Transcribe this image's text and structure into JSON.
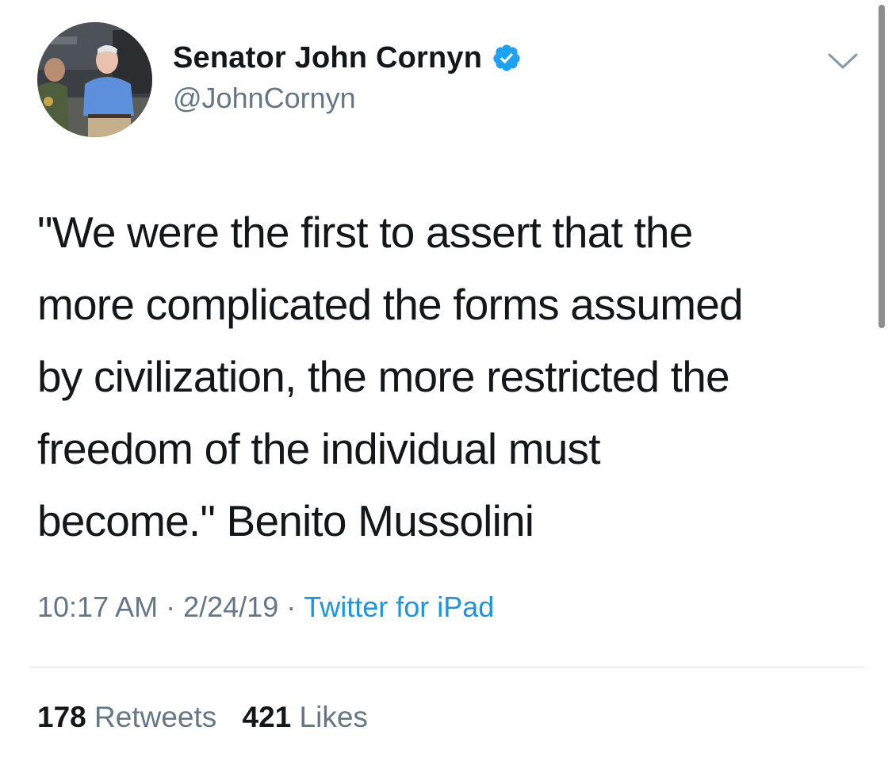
{
  "tweet": {
    "display_name": "Senator John Cornyn",
    "handle": "@JohnCornyn",
    "text": "\"We were the first to assert that the\nmore complicated the forms assumed\nby civilization, the more restricted the\nfreedom of the individual must\nbecome.\" Benito Mussolini",
    "time": "10:17 AM",
    "date": "2/24/19",
    "separator": "·",
    "source": "Twitter for iPad",
    "retweets_count": "178",
    "retweets_label": "Retweets",
    "likes_count": "421",
    "likes_label": "Likes"
  },
  "icons": {
    "verified": "verified-badge-icon",
    "more": "chevron-down-icon"
  },
  "colors": {
    "text": "#14171a",
    "secondary": "#657786",
    "link": "#1b95e0",
    "verified": "#1da1f2",
    "divider": "#dfe3e6"
  }
}
